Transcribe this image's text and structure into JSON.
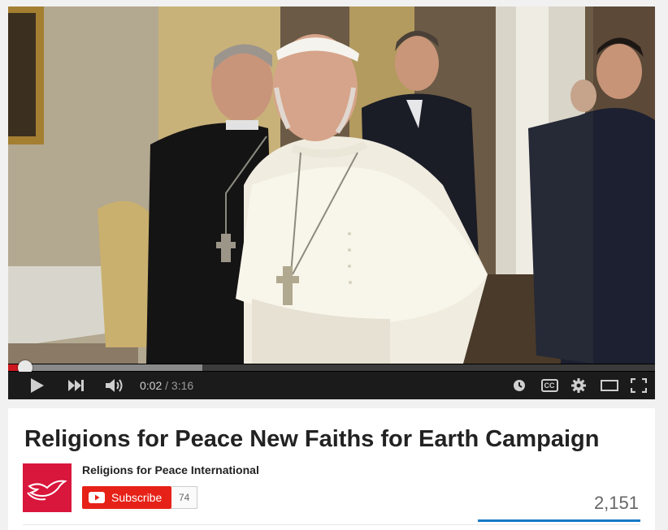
{
  "video": {
    "current_time": "0:02",
    "separator": " / ",
    "duration": "3:16",
    "played_fraction": 0.026,
    "buffered_fraction": 0.3
  },
  "controls": {
    "icons": [
      "play-icon",
      "next-icon",
      "volume-icon",
      "watch-later-icon",
      "captions-icon",
      "settings-icon",
      "theater-mode-icon",
      "fullscreen-icon"
    ],
    "captions_label": "CC"
  },
  "info": {
    "title": "Religions for Peace New Faiths for Earth Campaign",
    "channel_name": "Religions for Peace International",
    "subscribe_label": "Subscribe",
    "subscriber_count": "74",
    "view_count": "2,151"
  },
  "colors": {
    "progress_red": "#cc181e",
    "subscribe_red": "#e62117",
    "logo_red": "#d9163c",
    "sentiment_blue": "#167ac6"
  }
}
